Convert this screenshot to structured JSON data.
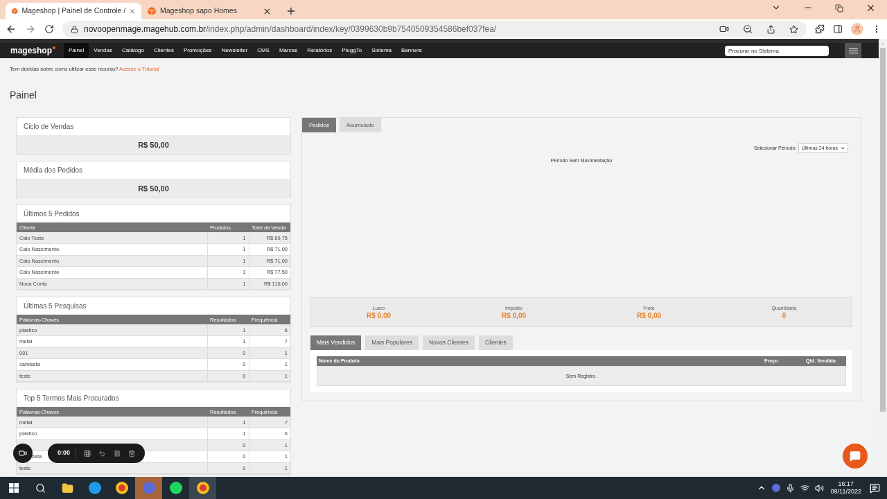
{
  "browser": {
    "tabs": [
      {
        "title": "Mageshop | Painel de Controle /",
        "selected": true
      },
      {
        "title": "Mageshop sapo Homes",
        "selected": false
      }
    ],
    "url_host": "novoopenmage.magehub.com.br",
    "url_path": "/index.php/admin/dashboard/index/key/0399630b9b7540509354586bef037fea/"
  },
  "admin_nav": {
    "logo": "mageshop",
    "items": [
      {
        "label": "Painel",
        "selected": true
      },
      {
        "label": "Vendas",
        "selected": false
      },
      {
        "label": "Catálogo",
        "selected": false
      },
      {
        "label": "Clientes",
        "selected": false
      },
      {
        "label": "Promoções",
        "selected": false
      },
      {
        "label": "Newsletter",
        "selected": false
      },
      {
        "label": "CMS",
        "selected": false
      },
      {
        "label": "Marcas",
        "selected": false
      },
      {
        "label": "Relatórios",
        "selected": false
      },
      {
        "label": "PluggTo",
        "selected": false
      },
      {
        "label": "Sistema",
        "selected": false
      },
      {
        "label": "Banners",
        "selected": false
      }
    ],
    "search": {
      "placeholder": "Procurar no Sistema"
    }
  },
  "help": {
    "text": "Tem dúvidas sobre como utilizar esse recurso?",
    "link": "Acesse o Tutorial"
  },
  "page_title": "Painel",
  "stat_cards": [
    {
      "title": "Ciclo de Vendas",
      "value": "R$ 50,00"
    },
    {
      "title": "Média dos Pedidos",
      "value": "R$ 50,00"
    }
  ],
  "tables": [
    {
      "title": "Últimos 5 Pedidos",
      "columns": [
        "Cliente",
        "Produtos",
        "Total da Venda"
      ],
      "rows": [
        {
          "cells": [
            "Caio Teste",
            "1",
            "R$ 69,75"
          ]
        },
        {
          "cells": [
            "Caio Nascimento",
            "1",
            "R$ 71,00"
          ]
        },
        {
          "cells": [
            "Caio Nascimento",
            "1",
            "R$ 71,00"
          ]
        },
        {
          "cells": [
            "Caio Nascimento",
            "1",
            "R$ 77,50"
          ]
        },
        {
          "cells": [
            "Nova Conta",
            "1",
            "R$ 110,00"
          ]
        }
      ]
    },
    {
      "title": "Últimas 5 Pesquisas",
      "columns": [
        "Palavras-Chaves",
        "Resultados",
        "Frequência"
      ],
      "rows": [
        {
          "cells": [
            "plastico",
            "1",
            "6"
          ]
        },
        {
          "cells": [
            "metal",
            "1",
            "7"
          ]
        },
        {
          "cells": [
            "001",
            "0",
            "1"
          ]
        },
        {
          "cells": [
            "camiseta",
            "0",
            "1"
          ]
        },
        {
          "cells": [
            "teste",
            "0",
            "1"
          ]
        }
      ]
    },
    {
      "title": "Top 5 Termos Mais Procurados",
      "columns": [
        "Palavras-Chaves",
        "Resultados",
        "Frequência"
      ],
      "rows": [
        {
          "cells": [
            "metal",
            "1",
            "7"
          ]
        },
        {
          "cells": [
            "plastico",
            "1",
            "6"
          ]
        },
        {
          "cells": [
            "",
            "0",
            "1"
          ]
        },
        {
          "cells": [
            "seta",
            "0",
            "1"
          ]
        },
        {
          "cells": [
            "teste",
            "0",
            "1"
          ]
        }
      ]
    }
  ],
  "chart_panel": {
    "tabs": [
      {
        "label": "Pedidos",
        "selected": true
      },
      {
        "label": "Acumulado",
        "selected": false
      }
    ],
    "period_label": "Selecionar Período:",
    "period_value": "Últimas 24 horas",
    "empty_message": "Período Sem Movimentação",
    "totals": [
      {
        "label": "Lucro",
        "value": "R$ 0,00"
      },
      {
        "label": "Imposto",
        "value": "R$ 0,00"
      },
      {
        "label": "Frete",
        "value": "R$ 0,00"
      },
      {
        "label": "Quantidade",
        "value": "0"
      }
    ],
    "list_tabs": [
      {
        "label": "Mais Vendidos",
        "selected": true
      },
      {
        "label": "Mais Populares",
        "selected": false
      },
      {
        "label": "Novos Clientes",
        "selected": false
      },
      {
        "label": "Clientes",
        "selected": false
      }
    ],
    "list_columns": [
      "Nome do Produto",
      "Preço",
      "Qtd. Vendida"
    ],
    "list_empty": "Sem Registro."
  },
  "recorder": {
    "time": "0:00"
  },
  "taskbar": {
    "time": "16:17",
    "date": "09/11/2022"
  }
}
